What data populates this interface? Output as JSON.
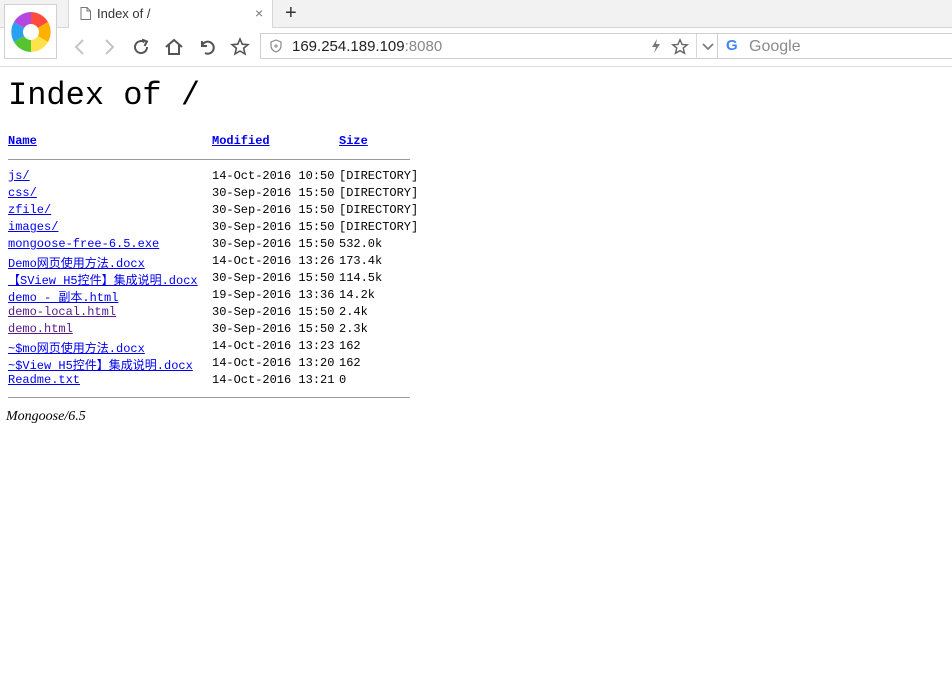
{
  "browser": {
    "tab": {
      "title": "Index of /",
      "close": "×"
    },
    "new_tab": "+",
    "url": {
      "host": "169.254.189.109",
      "port": ":8080"
    },
    "search": {
      "engine_letter": "G",
      "placeholder": "Google"
    }
  },
  "page": {
    "title": "Index of /",
    "columns": {
      "name": "Name",
      "modified": "Modified",
      "size": "Size"
    },
    "files": [
      {
        "name": "js/",
        "modified": "14-Oct-2016 10:50",
        "size": "[DIRECTORY]",
        "visited": false
      },
      {
        "name": "css/",
        "modified": "30-Sep-2016 15:50",
        "size": "[DIRECTORY]",
        "visited": false
      },
      {
        "name": "zfile/",
        "modified": "30-Sep-2016 15:50",
        "size": "[DIRECTORY]",
        "visited": false
      },
      {
        "name": "images/",
        "modified": "30-Sep-2016 15:50",
        "size": "[DIRECTORY]",
        "visited": false
      },
      {
        "name": "mongoose-free-6.5.exe",
        "modified": "30-Sep-2016 15:50",
        "size": "532.0k",
        "visited": false
      },
      {
        "name": "Demo网页使用方法.docx",
        "modified": "14-Oct-2016 13:26",
        "size": "173.4k",
        "visited": false
      },
      {
        "name": "【SView H5控件】集成说明.docx",
        "modified": "30-Sep-2016 15:50",
        "size": "114.5k",
        "visited": false
      },
      {
        "name": "demo - 副本.html",
        "modified": "19-Sep-2016 13:36",
        "size": "14.2k",
        "visited": false
      },
      {
        "name": "demo-local.html",
        "modified": "30-Sep-2016 15:50",
        "size": "2.4k",
        "visited": true
      },
      {
        "name": "demo.html",
        "modified": "30-Sep-2016 15:50",
        "size": "2.3k",
        "visited": true
      },
      {
        "name": "~$mo网页使用方法.docx",
        "modified": "14-Oct-2016 13:23",
        "size": "162",
        "visited": false
      },
      {
        "name": "~$View H5控件】集成说明.docx",
        "modified": "14-Oct-2016 13:20",
        "size": "162",
        "visited": false
      },
      {
        "name": "Readme.txt",
        "modified": "14-Oct-2016 13:21",
        "size": "0",
        "visited": false
      }
    ],
    "footer": "Mongoose/6.5"
  },
  "colors": {
    "link": "#0000ee",
    "visited_link": "#551a8b",
    "rule": "#9a9a9a"
  },
  "icons": [
    "browser-logo-icon",
    "page-icon",
    "back-icon",
    "forward-icon",
    "reload-icon",
    "home-icon",
    "undo-icon",
    "bookmark-star-icon",
    "shield-icon",
    "lightning-icon",
    "favorite-star-icon",
    "dropdown-chevron-icon",
    "google-icon"
  ]
}
